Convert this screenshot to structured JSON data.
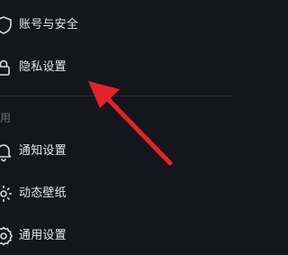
{
  "menu": {
    "account_items": [
      {
        "label": "账号与安全",
        "icon": "shield-icon"
      },
      {
        "label": "隐私设置",
        "icon": "lock-icon"
      }
    ],
    "general_section_title": "用",
    "general_items": [
      {
        "label": "通知设置",
        "icon": "bell-icon"
      },
      {
        "label": "动态壁纸",
        "icon": "wallpaper-icon"
      },
      {
        "label": "通用设置",
        "icon": "gear-icon"
      }
    ]
  },
  "colors": {
    "background": "#15161c",
    "text": "#e4e5eb",
    "muted": "#6d6f79",
    "annotation_arrow": "#e4222a"
  }
}
